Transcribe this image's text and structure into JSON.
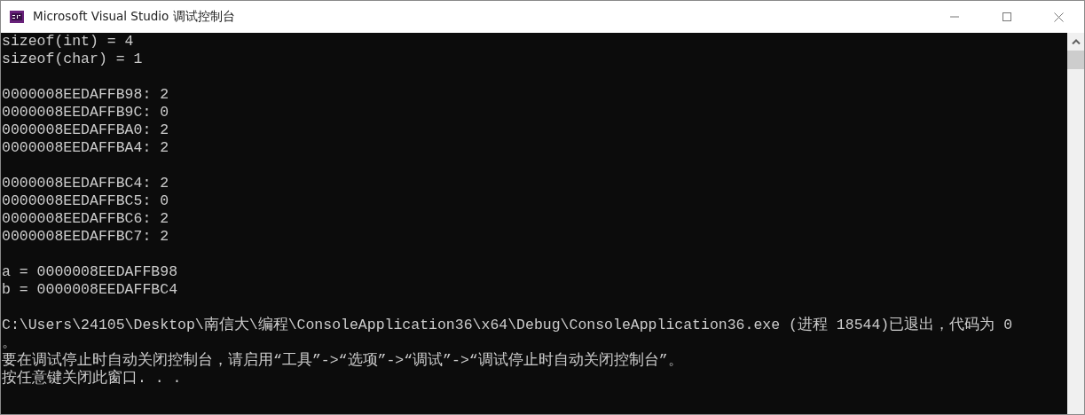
{
  "window": {
    "title": "Microsoft Visual Studio 调试控制台"
  },
  "console": {
    "blocks": [
      [
        "sizeof(int) = 4",
        "sizeof(char) = 1"
      ],
      [
        "0000008EEDAFFB98: 2",
        "0000008EEDAFFB9C: 0",
        "0000008EEDAFFBA0: 2",
        "0000008EEDAFFBA4: 2"
      ],
      [
        "0000008EEDAFFBC4: 2",
        "0000008EEDAFFBC5: 0",
        "0000008EEDAFFBC6: 2",
        "0000008EEDAFFBC7: 2"
      ],
      [
        "a = 0000008EEDAFFB98",
        "b = 0000008EEDAFFBC4"
      ],
      [
        "C:\\Users\\24105\\Desktop\\南信大\\编程\\ConsoleApplication36\\x64\\Debug\\ConsoleApplication36.exe (进程 18544)已退出，代码为 0",
        "。",
        "要在调试停止时自动关闭控制台，请启用“工具”->“选项”->“调试”->“调试停止时自动关闭控制台”。",
        "按任意键关闭此窗口. . ."
      ]
    ]
  }
}
